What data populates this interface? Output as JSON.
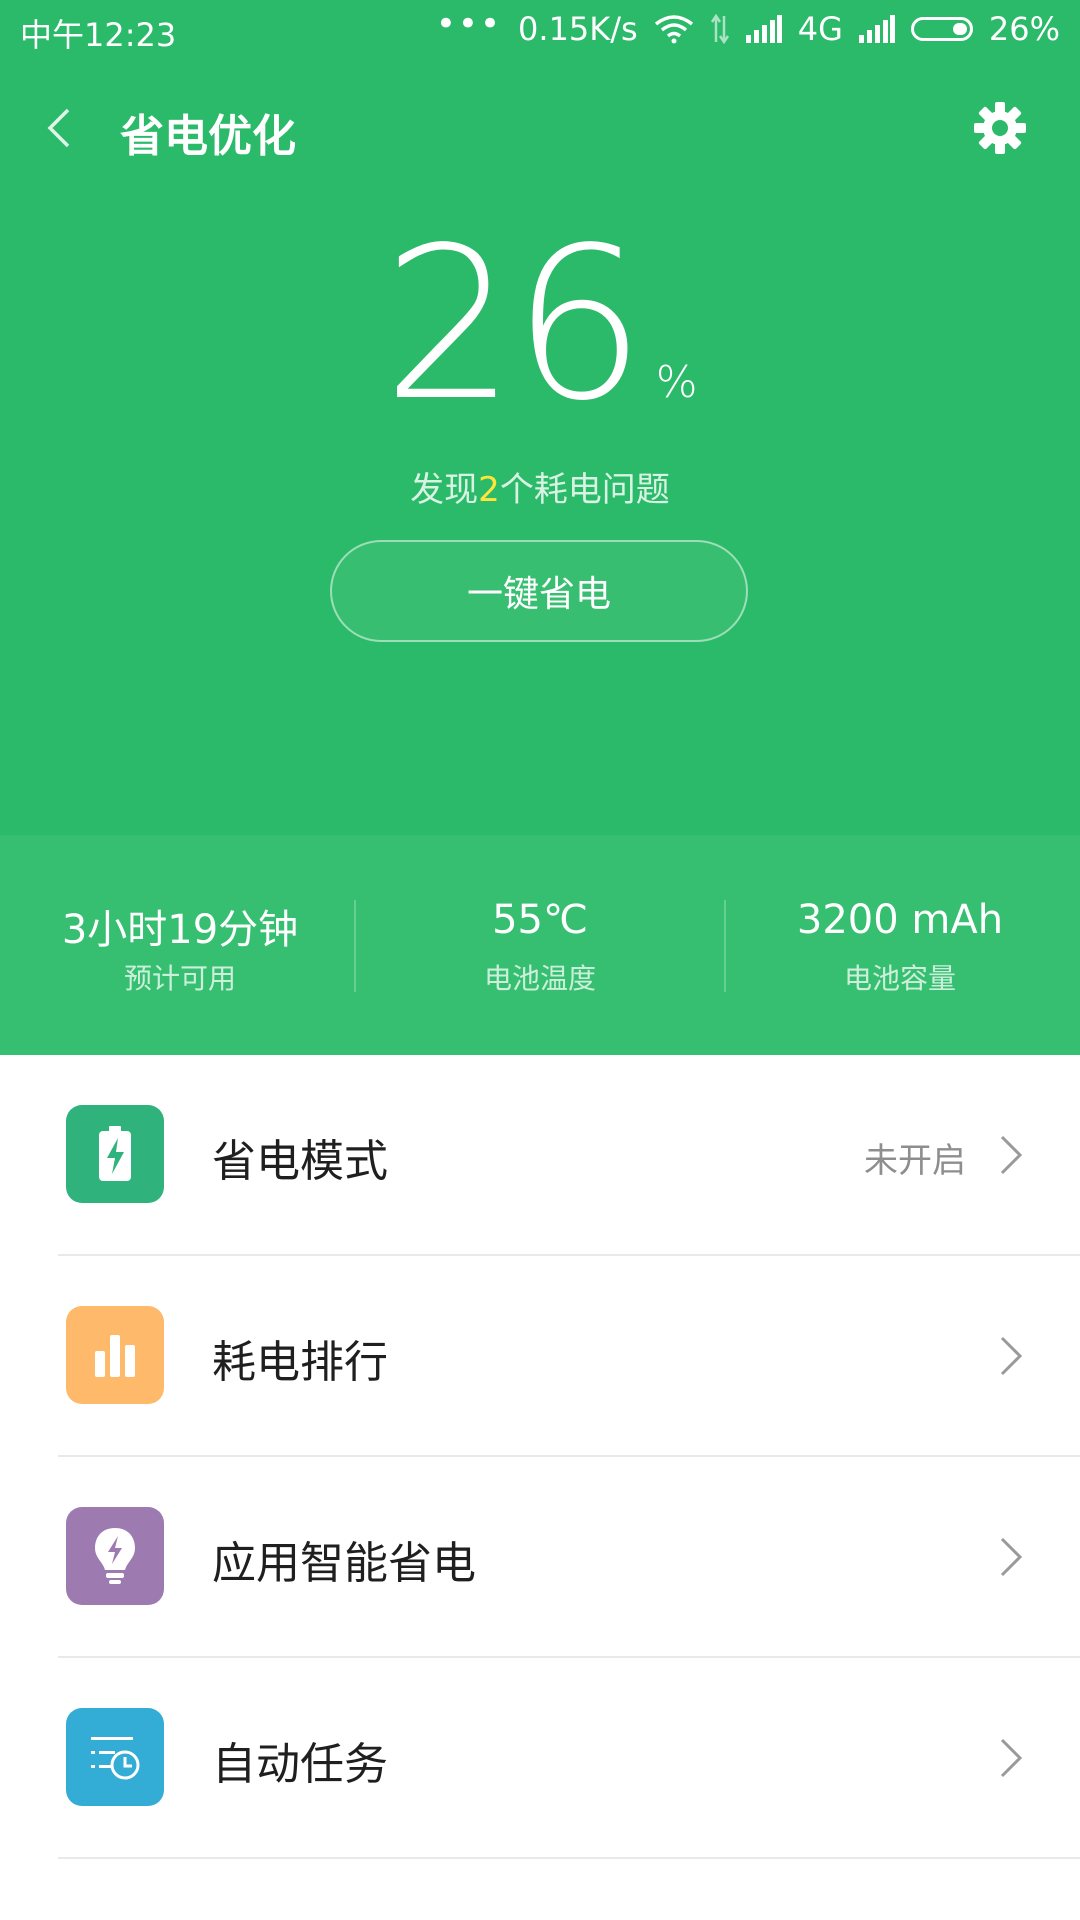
{
  "status_bar": {
    "time": "中午12:23",
    "dots": "•••",
    "network_speed": "0.15K/s",
    "network_type": "4G",
    "battery_text": "26%"
  },
  "header": {
    "title": "省电优化",
    "back_icon": "chevron-left-icon",
    "settings_icon": "gear-icon"
  },
  "battery": {
    "percent": "26",
    "percent_sign": "%",
    "issues_prefix": "发现",
    "issues_count": "2",
    "issues_suffix": "个耗电问题",
    "optimize_button": "一键省电"
  },
  "stats": [
    {
      "value": "3小时19分钟",
      "label": "预计可用"
    },
    {
      "value": "55℃",
      "label": "电池温度"
    },
    {
      "value": "3200 mAh",
      "label": "电池容量"
    }
  ],
  "menu": [
    {
      "label": "省电模式",
      "status": "未开启",
      "icon": "battery-charge-icon",
      "color": "#2fb27c"
    },
    {
      "label": "耗电排行",
      "status": "",
      "icon": "bar-chart-icon",
      "color": "#ffb96a"
    },
    {
      "label": "应用智能省电",
      "status": "",
      "icon": "lightbulb-icon",
      "color": "#9d7bb0"
    },
    {
      "label": "自动任务",
      "status": "",
      "icon": "schedule-list-icon",
      "color": "#33acd6"
    }
  ],
  "colors": {
    "brand_green": "#2bba69",
    "stats_green": "#36bf71",
    "highlight_yellow": "#ffe53b"
  }
}
